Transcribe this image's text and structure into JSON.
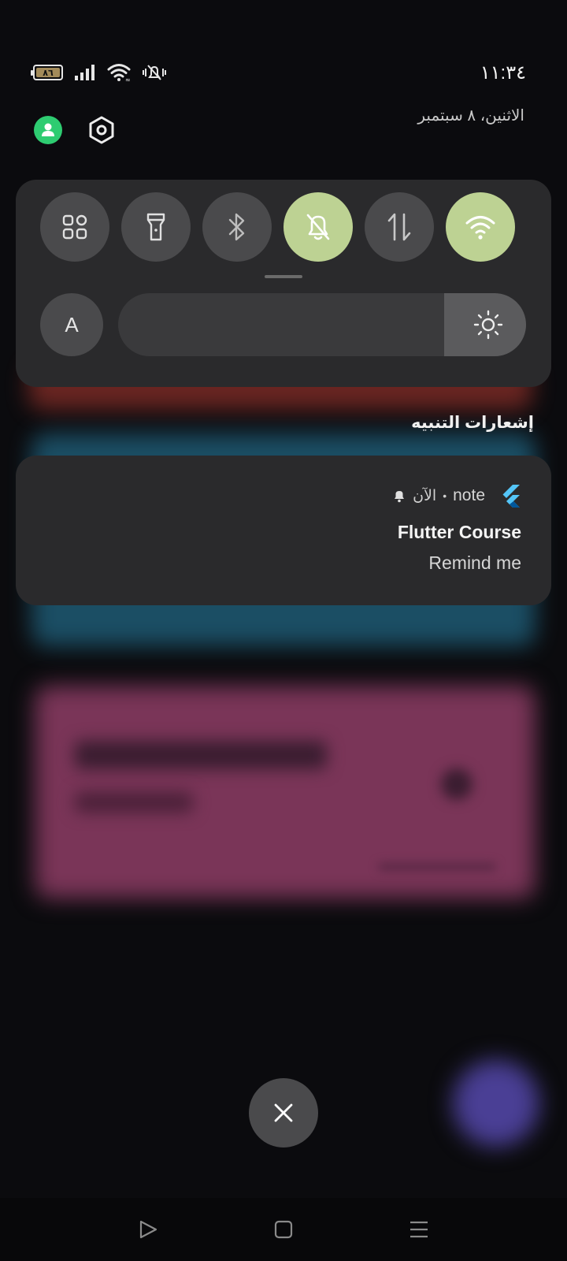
{
  "status_bar": {
    "battery_level": "٨٦",
    "time": "١١:٣٤",
    "date": "الاثنين، ٨ سبتمبر"
  },
  "quick_settings": {
    "tiles": [
      {
        "name": "apps-grid",
        "icon": "grid-icon",
        "active": false
      },
      {
        "name": "flashlight",
        "icon": "flashlight-icon",
        "active": false
      },
      {
        "name": "bluetooth",
        "icon": "bluetooth-icon",
        "active": false
      },
      {
        "name": "silent-mode",
        "icon": "bell-off-icon",
        "active": true
      },
      {
        "name": "mobile-data",
        "icon": "data-arrows-icon",
        "active": false
      },
      {
        "name": "wifi",
        "icon": "wifi-icon",
        "active": true
      }
    ],
    "auto_brightness_label": "A",
    "brightness_level": 0.2
  },
  "notifications": {
    "section_title": "إشعارات التنبيه",
    "items": [
      {
        "app": "note",
        "separator": "•",
        "time": "الآن",
        "title": "Flutter Course",
        "body": "Remind me"
      }
    ]
  },
  "colors": {
    "active_tile": "#bdd293",
    "tile": "#4a4a4c",
    "panel": "#2a2a2c",
    "avatar": "#2ecc71",
    "flutter_blue": "#54c5f8"
  }
}
